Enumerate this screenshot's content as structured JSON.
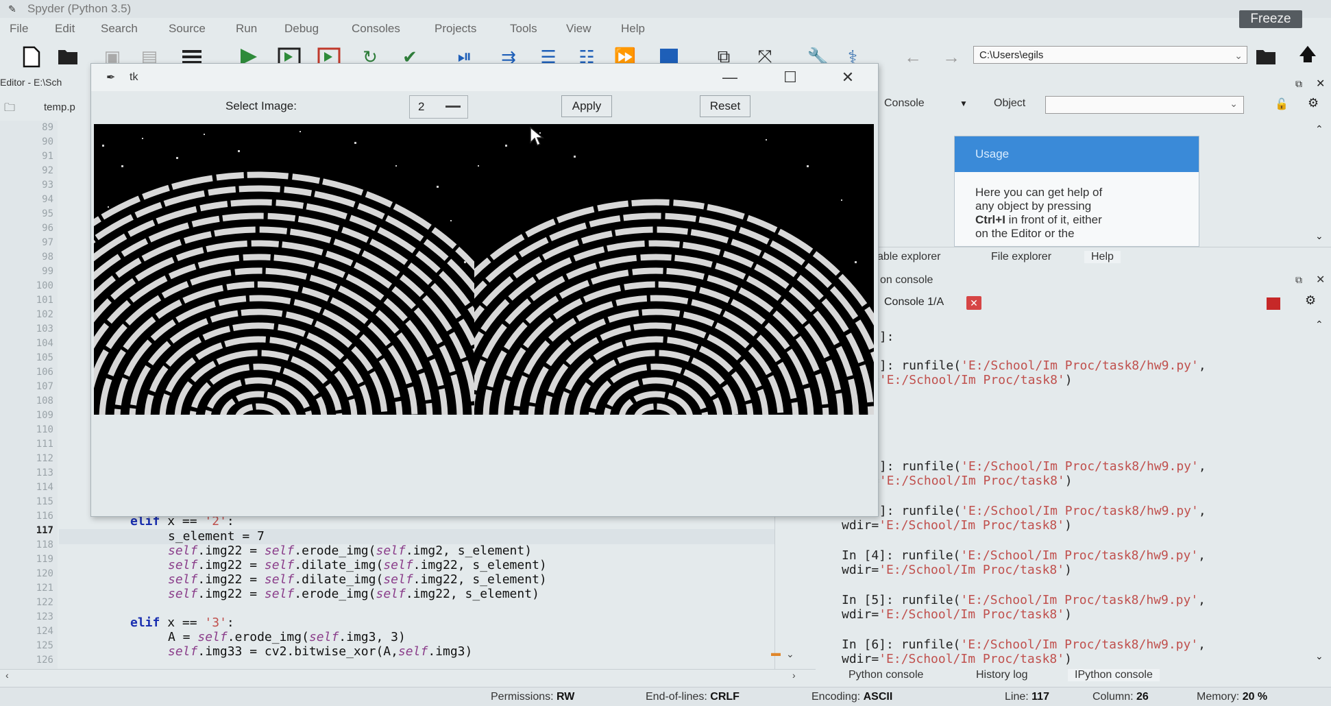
{
  "app": {
    "title": "Spyder (Python 3.5)",
    "freeze_label": "Freeze"
  },
  "menu": [
    "File",
    "Edit",
    "Search",
    "Source",
    "Run",
    "Debug",
    "Consoles",
    "Projects",
    "Tools",
    "View",
    "Help"
  ],
  "toolbar": {
    "path": "C:\\Users\\egils"
  },
  "editor": {
    "header": "Editor - E:\\Sch",
    "tab": "temp.p",
    "line_numbers": [
      "89",
      "90",
      "91",
      "92",
      "93",
      "94",
      "95",
      "96",
      "97",
      "98",
      "99",
      "100",
      "101",
      "102",
      "103",
      "104",
      "105",
      "106",
      "107",
      "108",
      "109",
      "110",
      "111",
      "112",
      "113",
      "114",
      "115",
      "116",
      "117",
      "118",
      "119",
      "120",
      "121",
      "122",
      "123",
      "124",
      "125",
      "126"
    ],
    "code": {
      "l116_kw": "elif",
      "l116_rest": " x == ",
      "l116_str": "'2'",
      "l116_tail": ":",
      "l117": "s_element = 7",
      "self": "self",
      "l118": ".img22 = ",
      "l118b": ".erode_img(",
      "l118c": ".img2, s_element)",
      "l119b": ".dilate_img(",
      "l119c": ".img22, s_element)",
      "l121b": ".erode_img(",
      "l121c": ".img22, s_element)",
      "l123_kw": "elif",
      "l123_rest": " x == ",
      "l123_str": "'3'",
      "l123_tail": ":",
      "l124a": "A = ",
      "l124b": ".erode_img(",
      "l124c": ".img3, 3)",
      "l125a": ".img33 = cv2.bitwise_xor(A,",
      "l125b": ".img3)"
    }
  },
  "help": {
    "source_label": "Console",
    "object_label": "Object",
    "usage_title": "Usage",
    "usage_line1": "Here you can get help of",
    "usage_line2": "any object by pressing",
    "usage_bold": "Ctrl+I",
    "usage_line3_rest": " in front of it, either",
    "usage_line4": "on the Editor or the",
    "tabs": [
      "able explorer",
      "File explorer",
      "Help"
    ]
  },
  "console": {
    "title": "on console",
    "tab": "Console 1/A",
    "lines": {
      "a": "1]:",
      "b1": "1]: runfile(",
      "b1s": "'E:/School/Im Proc/task8/hw9.py'",
      "b1t": ",",
      "b2": "=",
      "b2s": "'E:/School/Im Proc/task8'",
      "b2t": ")",
      "c1": ")",
      "c2": ")",
      "c3": ")",
      "d1": "2]: runfile(",
      "d2": "=",
      "e1": "3]: runfile(",
      "e2": "wdir=",
      "f1": "In [4]: runfile(",
      "f2": "wdir=",
      "g1": "In [5]: runfile(",
      "g2": "wdir=",
      "h1": "In [6]: runfile(",
      "h2": "wdir="
    },
    "bottom_tabs": [
      "Python console",
      "History log",
      "IPython console"
    ]
  },
  "tk": {
    "title": "tk",
    "select_label": "Select Image:",
    "select_value": "2",
    "apply": "Apply",
    "reset": "Reset"
  },
  "status": {
    "permissions_label": "Permissions:",
    "permissions_value": "RW",
    "eol_label": "End-of-lines:",
    "eol_value": "CRLF",
    "encoding_label": "Encoding:",
    "encoding_value": "ASCII",
    "line_label": "Line:",
    "line_value": "117",
    "column_label": "Column:",
    "column_value": "26",
    "memory_label": "Memory:",
    "memory_value": "20 %"
  }
}
